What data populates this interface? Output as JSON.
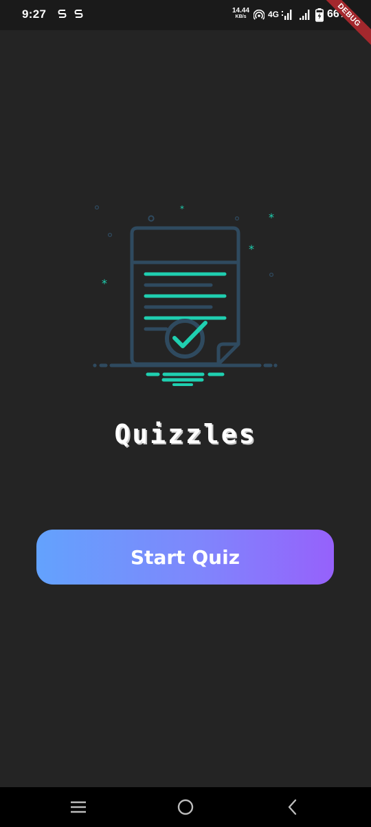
{
  "status_bar": {
    "time": "9:27",
    "left_icons": [
      "notification-s-icon",
      "notification-s-icon"
    ],
    "speed_value": "14.44",
    "speed_unit": "KB/s",
    "network_type": "4G",
    "battery_level": "66%",
    "right_icons": [
      "hotspot-icon",
      "signal-4g-icon",
      "signal-icon",
      "battery-charging-icon"
    ]
  },
  "debug_banner": {
    "label": "DEBUG",
    "color": "#a3282d"
  },
  "main": {
    "title": "Quizzles",
    "start_button_label": "Start Quiz",
    "illustration": "quiz-document-checkmark-illustration"
  },
  "navigation": {
    "buttons": [
      "menu-icon",
      "home-icon",
      "back-icon"
    ]
  },
  "colors": {
    "background": "#242424",
    "accent_teal": "#1fcfb0",
    "outline": "#2f4a5f",
    "button_gradient_start": "#63a2fd",
    "button_gradient_end": "#9661fb"
  }
}
